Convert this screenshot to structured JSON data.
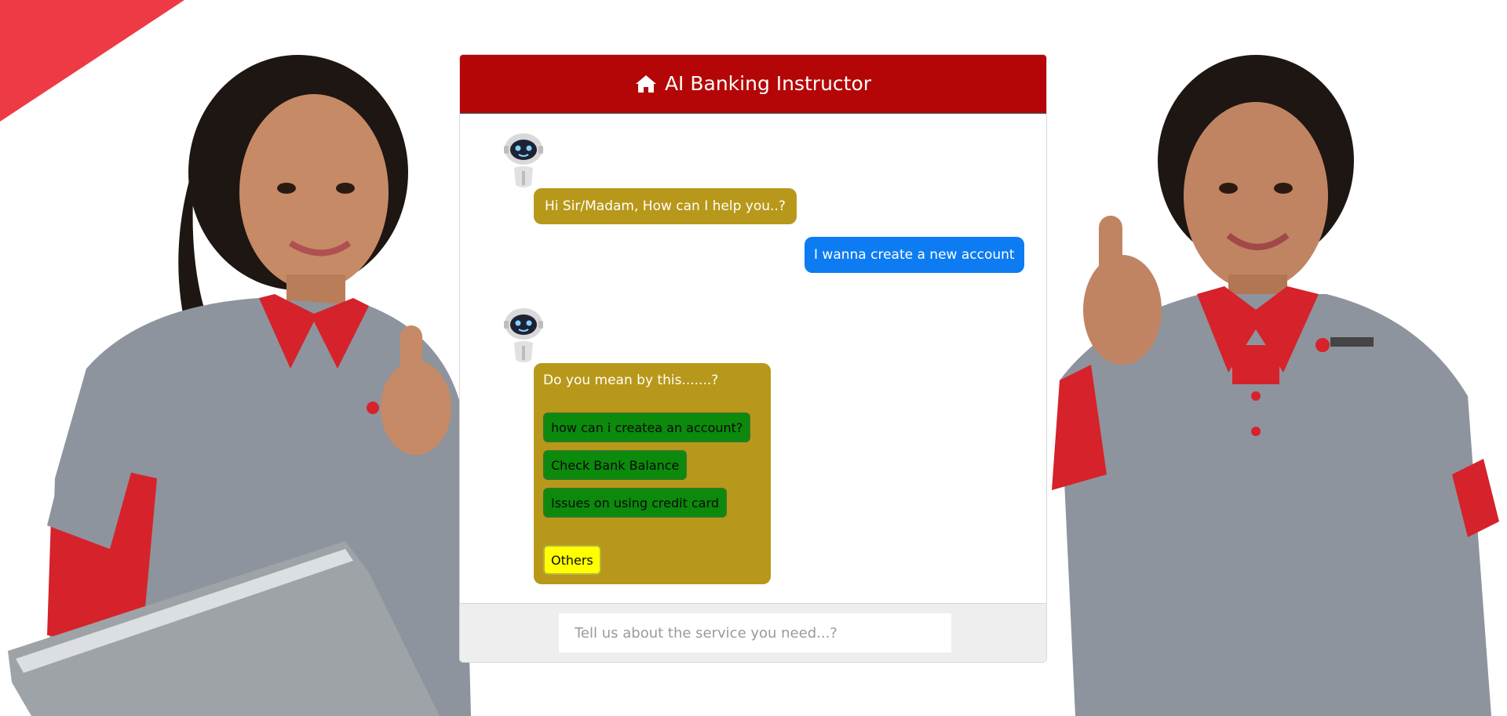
{
  "header": {
    "icon": "home-icon",
    "title": "AI Banking Instructor",
    "color": "#b40606"
  },
  "messages": {
    "bot_greeting": "Hi Sir/Madam, How can I help you..?",
    "user_message": "I wanna create a new account",
    "bot_suggestion_title": "Do you mean by this.......?",
    "options": [
      "how can i createa an account?",
      "Check Bank Balance",
      "Issues on using credit card"
    ],
    "others_label": "Others"
  },
  "input": {
    "placeholder": "Tell us about the service you need...?"
  },
  "colors": {
    "bot_bubble": "#b8981a",
    "user_bubble": "#0d7cf2",
    "option_button": "#0b8a0b",
    "others_button": "#ffff00",
    "corner_accent": "#ee3a45"
  }
}
